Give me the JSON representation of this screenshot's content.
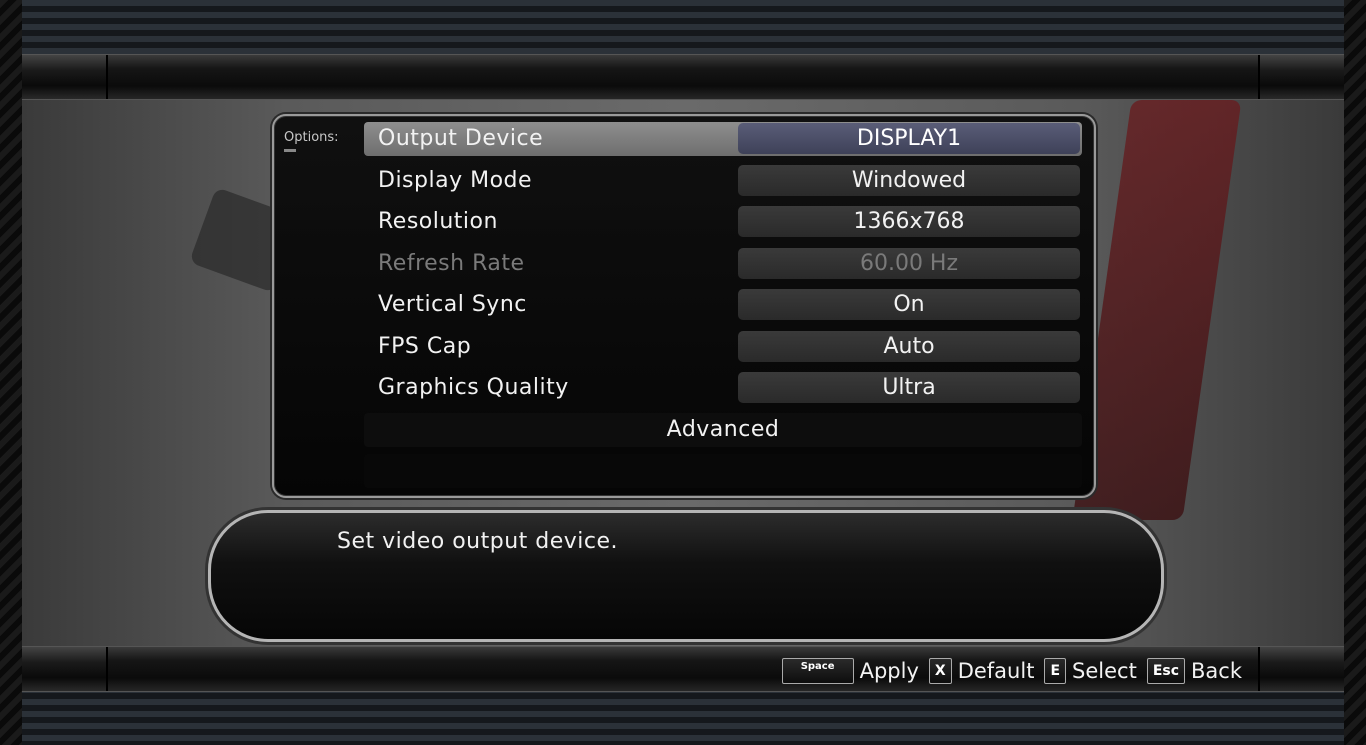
{
  "options_tab": {
    "label": "Options:"
  },
  "settings": [
    {
      "label": "Output Device",
      "value": "DISPLAY1"
    },
    {
      "label": "Display Mode",
      "value": "Windowed"
    },
    {
      "label": "Resolution",
      "value": "1366x768"
    },
    {
      "label": "Refresh Rate",
      "value": "60.00 Hz"
    },
    {
      "label": "Vertical Sync",
      "value": "On"
    },
    {
      "label": "FPS Cap",
      "value": "Auto"
    },
    {
      "label": "Graphics Quality",
      "value": "Ultra"
    }
  ],
  "advanced": {
    "label": "Advanced"
  },
  "help": {
    "text": "Set video output device."
  },
  "hints": [
    {
      "key": "Space",
      "label": "Apply"
    },
    {
      "key": "X",
      "label": "Default"
    },
    {
      "key": "E",
      "label": "Select"
    },
    {
      "key": "Esc",
      "label": "Back"
    }
  ]
}
